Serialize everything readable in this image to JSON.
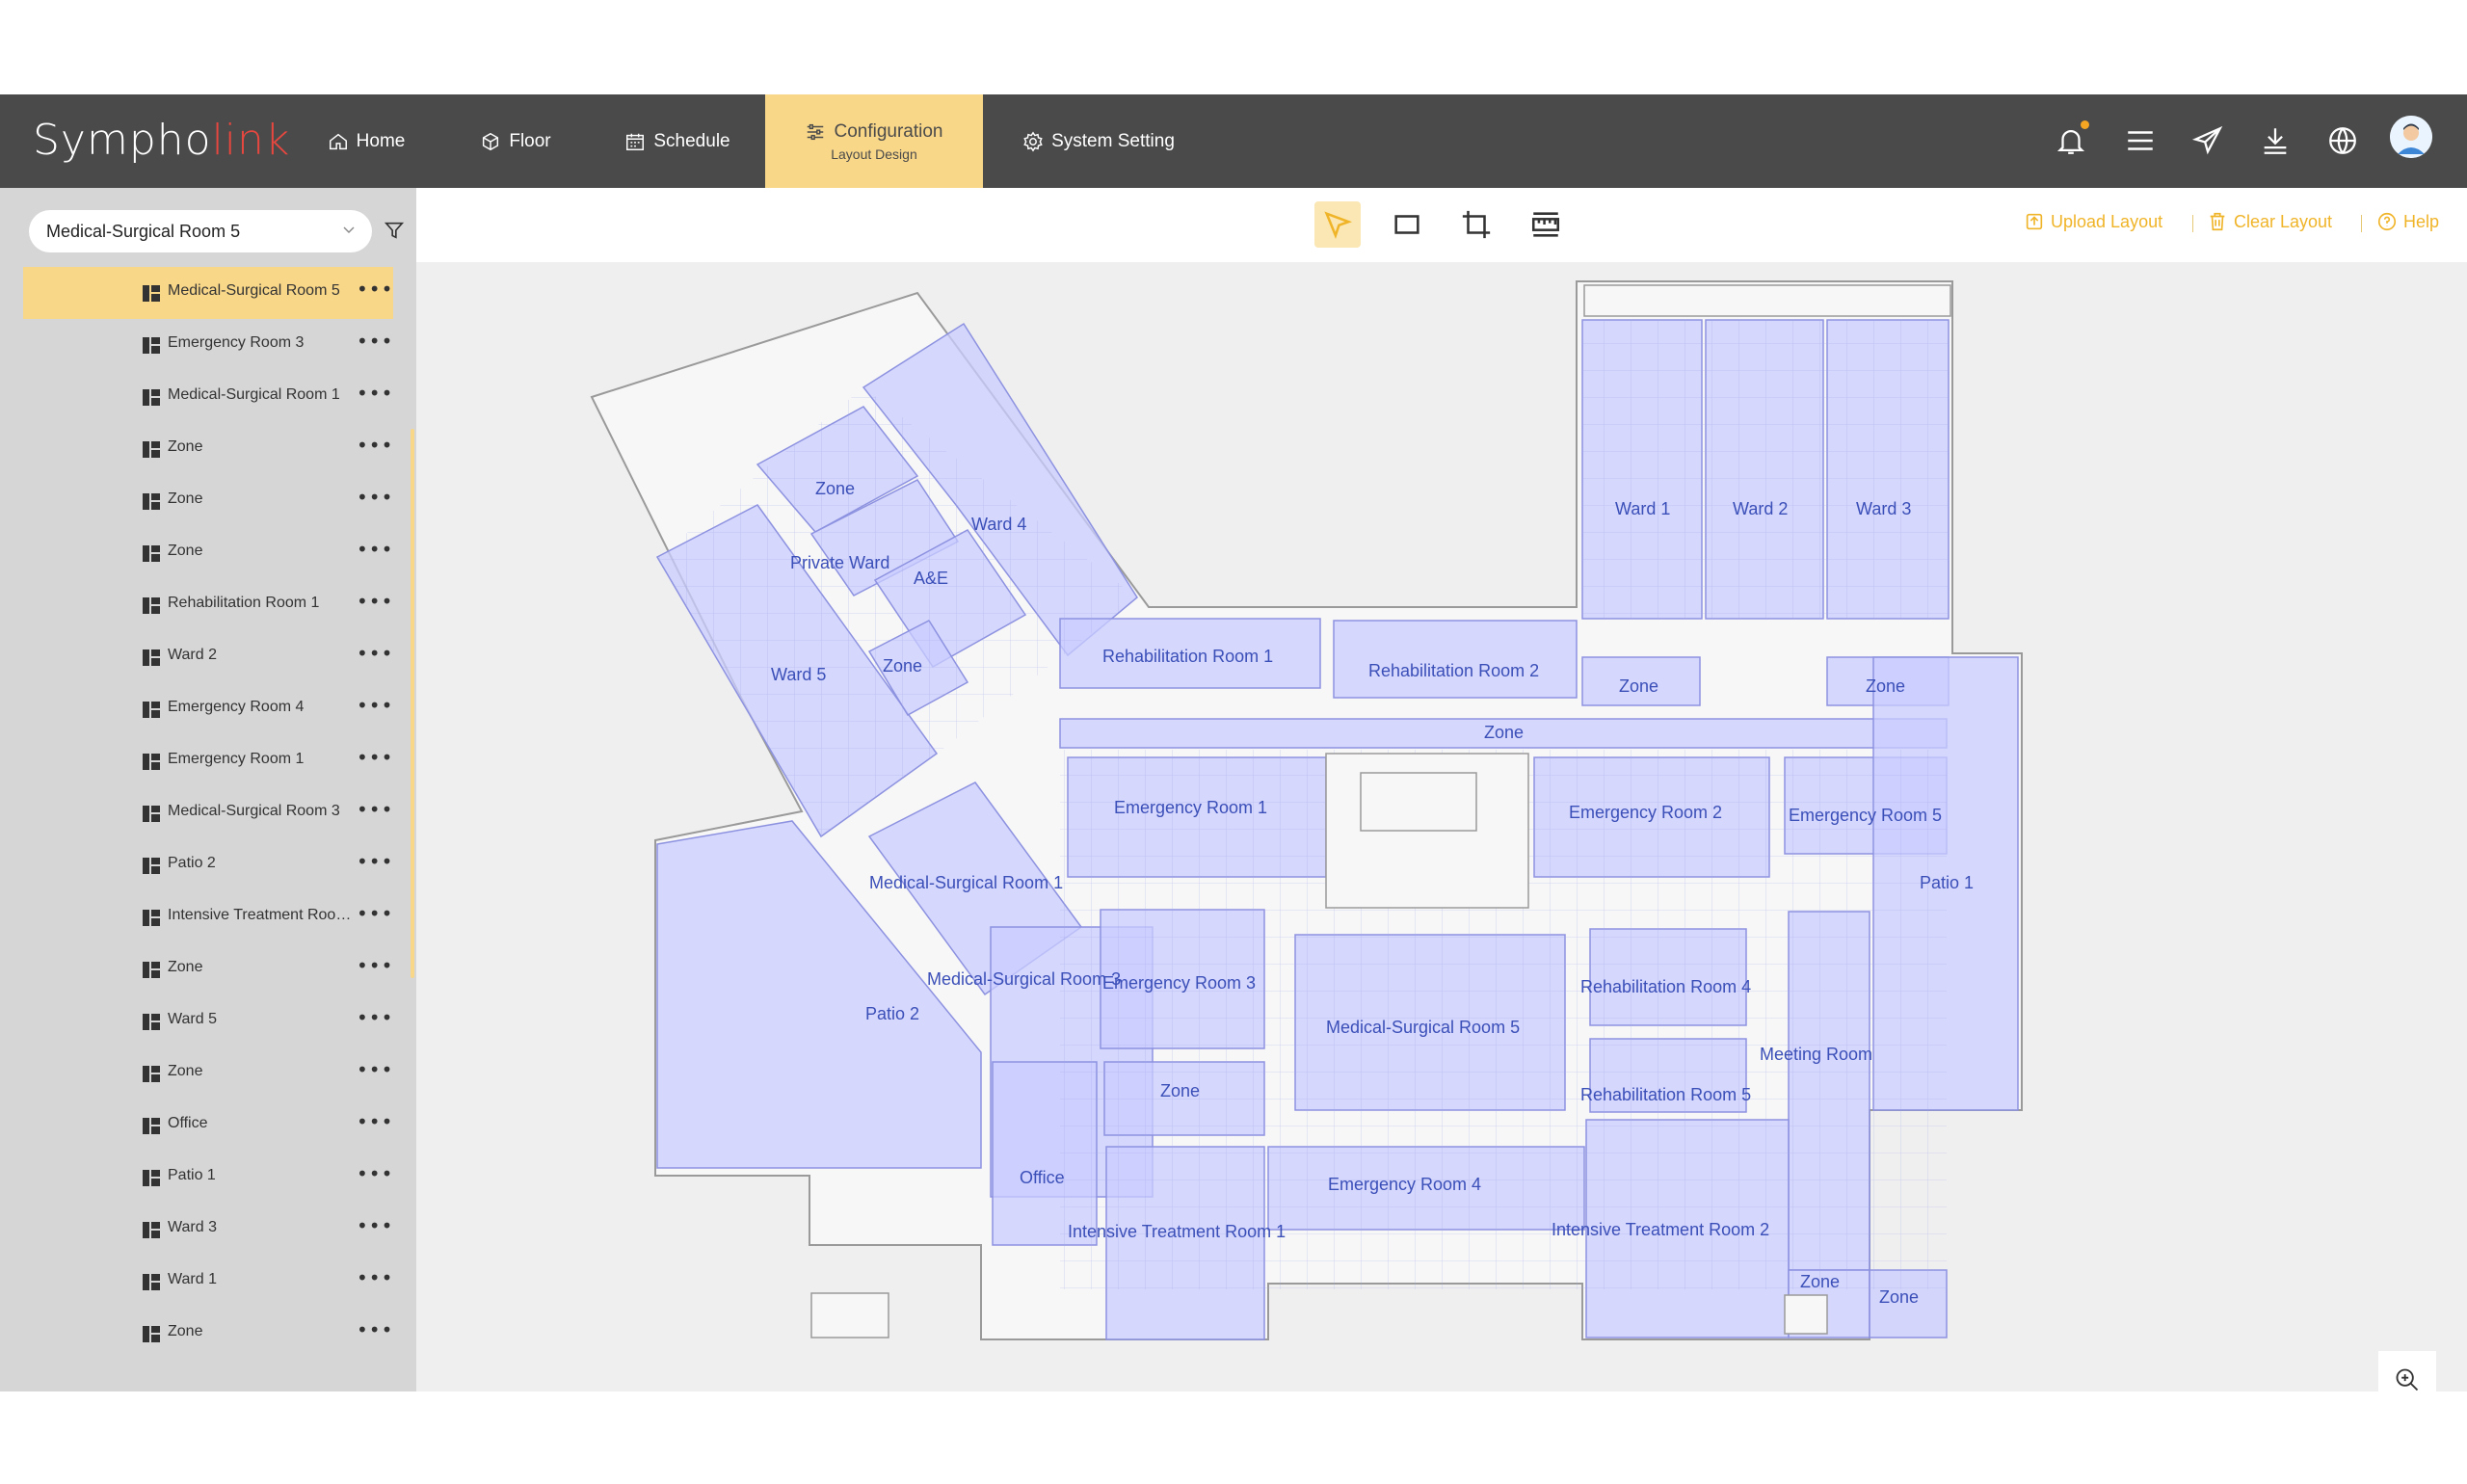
{
  "app": {
    "logo_part1": "Sympho",
    "logo_part2": "link"
  },
  "nav": [
    {
      "label": "Home",
      "icon": "home-icon"
    },
    {
      "label": "Floor",
      "icon": "cube-icon"
    },
    {
      "label": "Schedule",
      "icon": "calendar-icon"
    },
    {
      "label": "Configuration",
      "sublabel": "Layout Design",
      "icon": "sliders-icon",
      "active": true
    },
    {
      "label": "System Setting",
      "icon": "gear-icon"
    }
  ],
  "colors": {
    "topbar": "#4a4a4a",
    "accent": "#f9d789",
    "accent_text": "#f0b429",
    "logo_red": "#e8473f",
    "zone_fill": "#c9ccff",
    "zone_label": "#3b4fb8"
  },
  "sidebar": {
    "selected_room": "Medical-Surgical Room 5",
    "items": [
      {
        "label": "Medical-Surgical Room 5",
        "selected": true
      },
      {
        "label": "Emergency Room 3"
      },
      {
        "label": "Medical-Surgical Room 1"
      },
      {
        "label": "Zone"
      },
      {
        "label": "Zone"
      },
      {
        "label": "Zone"
      },
      {
        "label": "Rehabilitation Room 1"
      },
      {
        "label": "Ward 2"
      },
      {
        "label": "Emergency Room 4"
      },
      {
        "label": "Emergency Room 1"
      },
      {
        "label": "Medical-Surgical Room 3"
      },
      {
        "label": "Patio 2"
      },
      {
        "label": "Intensive Treatment Room 1"
      },
      {
        "label": "Zone"
      },
      {
        "label": "Ward 5"
      },
      {
        "label": "Zone"
      },
      {
        "label": "Office"
      },
      {
        "label": "Patio 1"
      },
      {
        "label": "Ward 3"
      },
      {
        "label": "Ward 1"
      },
      {
        "label": "Zone"
      }
    ],
    "more_glyph": "•••"
  },
  "toolbar": {
    "tools": [
      "select-tool-icon",
      "rectangle-tool-icon",
      "crop-tool-icon",
      "ruler-tool-icon"
    ],
    "upload_label": "Upload Layout",
    "clear_label": "Clear Layout",
    "help_label": "Help"
  },
  "floorplan": {
    "labels": {
      "zone_nw": "Zone",
      "ward4": "Ward 4",
      "private_ward": "Private Ward",
      "ae": "A&E",
      "ward5": "Ward 5",
      "zone_w": "Zone",
      "ward1": "Ward 1",
      "ward2": "Ward 2",
      "ward3": "Ward 3",
      "rehab1": "Rehabilitation Room 1",
      "rehab2": "Rehabilitation Room 2",
      "zone_ne1": "Zone",
      "zone_ne2": "Zone",
      "zone_corridor": "Zone",
      "emergency1": "Emergency Room 1",
      "emergency2": "Emergency Room 2",
      "emergency5": "Emergency Room 5",
      "patio1": "Patio 1",
      "medsurg1": "Medical-Surgical Room 1",
      "medsurg3": "Medical-Surgical Room 3",
      "emergency3": "Emergency Room 3",
      "rehab4": "Rehabilitation Room 4",
      "medsurg5": "Medical-Surgical Room 5",
      "meeting": "Meeting Room",
      "patio2": "Patio 2",
      "zone_mid": "Zone",
      "rehab5": "Rehabilitation Room 5",
      "office": "Office",
      "emergency4": "Emergency Room 4",
      "itr1": "Intensive Treatment Room 1",
      "itr2": "Intensive Treatment Room 2",
      "zone_s1": "Zone",
      "zone_s2": "Zone"
    }
  }
}
